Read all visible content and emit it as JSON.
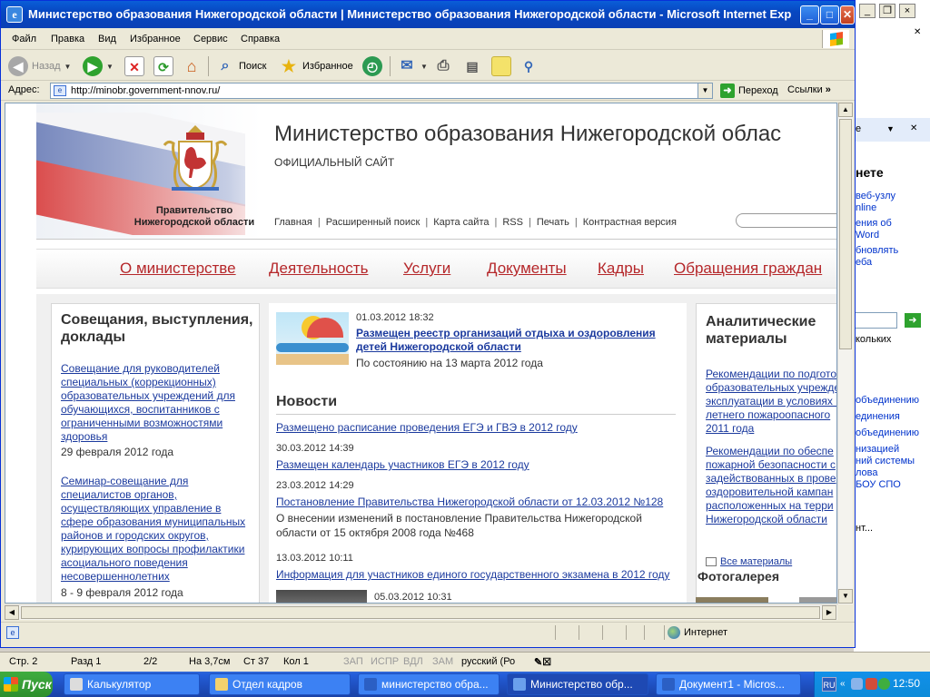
{
  "ie": {
    "title": "Министерство образования Нижегородской области | Министерство образования Нижегородской области - Microsoft Internet Explorer",
    "menu": [
      "Файл",
      "Правка",
      "Вид",
      "Избранное",
      "Сервис",
      "Справка"
    ],
    "toolbar": {
      "back": "Назад",
      "search": "Поиск",
      "favorites": "Избранное"
    },
    "address_label": "Адрес:",
    "url": "http://minobr.government-nnov.ru/",
    "go": "Переход",
    "links": "Ссылки",
    "status_zone": "Интернет"
  },
  "site": {
    "title": "Министерство образования Нижегородской облас",
    "subtitle": "ОФИЦИАЛЬНЫЙ САЙТ",
    "gov_line1": "Правительство",
    "gov_line2": "Нижегородской области",
    "toplinks": [
      "Главная",
      "Расширенный поиск",
      "Карта сайта",
      "RSS",
      "Печать",
      "Контрастная версия"
    ],
    "nav": [
      "О министерстве",
      "Деятельность",
      "Услуги",
      "Документы",
      "Кадры",
      "Обращения граждан"
    ],
    "left": {
      "heading": "Совещания, выступления, доклады",
      "items": [
        {
          "lines": [
            "Совещание для руководителей",
            "специальных (коррекционных)",
            "образовательных учреждений для",
            "обучающихся, воспитанников с",
            "ограниченными возможностями",
            "здоровья"
          ],
          "date": "29 февраля 2012 года"
        },
        {
          "lines": [
            "Семинар-совещание для",
            "специалистов органов,",
            "осуществляющих управление в",
            "сфере образования муниципальных",
            "районов и городских округов,",
            "курирующих вопросы профилактики",
            "асоциального поведения",
            "несовершеннолетних"
          ],
          "date": "8 - 9 февраля 2012 года"
        }
      ]
    },
    "featured": {
      "date": "01.03.2012 18:32",
      "title_lines": [
        "Размещен реестр организаций отдыха и оздоровления",
        "детей Нижегородской области"
      ],
      "note": "По состоянию на 13 марта 2012 года"
    },
    "news_heading": "Новости",
    "news": [
      {
        "date": "",
        "title": "Размещено расписание проведения ЕГЭ и ГВЭ в 2012 году",
        "desc": []
      },
      {
        "date": "30.03.2012 14:39",
        "title": "Размещен календарь участников ЕГЭ в 2012 году",
        "desc": []
      },
      {
        "date": "23.03.2012 14:29",
        "title": "Постановление Правительства Нижегородской области от 12.03.2012 №128",
        "desc": [
          "О внесении изменений в постановление Правительства Нижегородской",
          "области от 15 октября 2008 года №468"
        ]
      },
      {
        "date": "13.03.2012 10:11",
        "title": "Информация для участников единого государственного экзамена в 2012 году",
        "desc": []
      },
      {
        "date": "05.03.2012 10:31",
        "title": "",
        "desc": []
      }
    ],
    "right": {
      "heading_lines": [
        "Аналитические",
        "материалы"
      ],
      "items": [
        {
          "lines": [
            "Рекомендации по подгото",
            "образовательных учрежде",
            "эксплуатации в условиях в",
            "летнего пожароопасного",
            "2011 года"
          ]
        },
        {
          "lines": [
            "Рекомендации по обеспе",
            "пожарной безопасности с",
            "задействованных в прове",
            "оздоровительной кампан",
            "расположенных на терри",
            "Нижегородской области"
          ]
        }
      ],
      "all_link": "Все материалы",
      "photo_heading": "Фотогалерея"
    }
  },
  "word_bg": {
    "pane": [
      "е",
      "нете",
      "веб-узлу",
      "nline",
      "ения об",
      "Word",
      "бновлять",
      "еба",
      "кольких",
      "объединению",
      "единения",
      "объединению",
      "низацией",
      "ний системы",
      "лова",
      "БОУ СПО",
      "нт..."
    ],
    "status": {
      "page": "Стр. 2",
      "section": "Разд 1",
      "pages": "2/2",
      "pos": "На 3,7см",
      "line": "Ст 37",
      "col": "Кол 1",
      "rec": "ЗАП",
      "trk": "ИСПР",
      "ext": "ВДЛ",
      "ovr": "ЗАМ",
      "lang": "русский (Ро"
    }
  },
  "taskbar": {
    "start": "Пуск",
    "tasks": [
      "Калькулятор",
      "Отдел кадров",
      "министерство обра...",
      "Министерство обр...",
      "Документ1 - Micros..."
    ],
    "lang": "RU",
    "clock": "12:50"
  }
}
